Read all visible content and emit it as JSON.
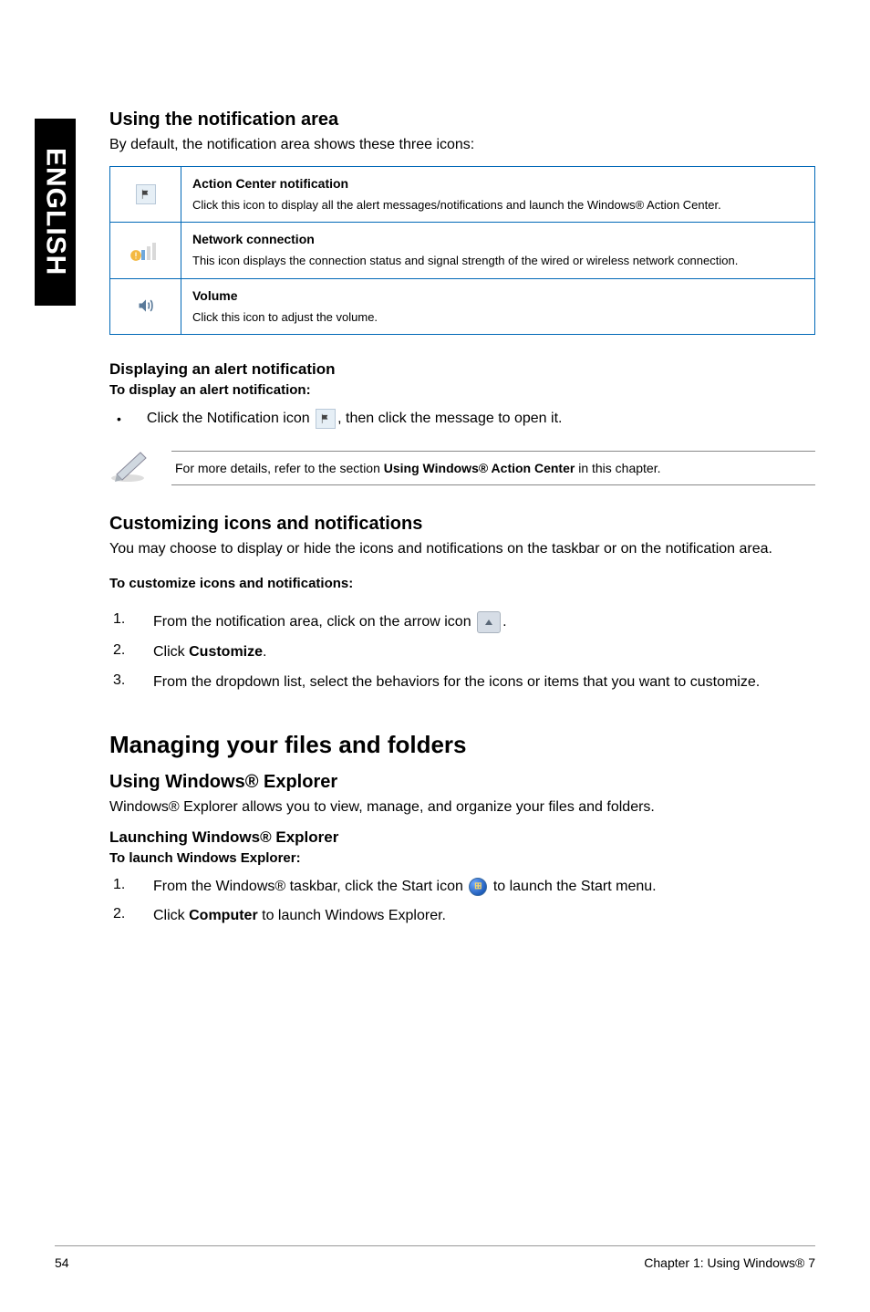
{
  "sidebar": {
    "language": "ENGLISH"
  },
  "section1": {
    "title": "Using the notification area",
    "intro": "By default, the notification area shows these three icons:"
  },
  "table": {
    "row1": {
      "title": "Action Center notification",
      "desc": "Click this icon to display all the alert messages/notifications and launch the Windows® Action Center."
    },
    "row2": {
      "title": "Network connection",
      "desc": "This icon displays the connection status and signal strength of the wired or wireless network connection."
    },
    "row3": {
      "title": "Volume",
      "desc": "Click this icon to adjust the volume."
    }
  },
  "section2": {
    "title": "Displaying an alert notification",
    "subtitle": "To display an alert notification:",
    "bullet_pre": "Click the Notification icon",
    "bullet_post": ", then click the message to open it."
  },
  "note": {
    "pre": "For more details, refer to the section ",
    "bold": "Using Windows® Action Center",
    "post": " in this chapter."
  },
  "section3": {
    "title": "Customizing icons and notifications",
    "intro": "You may choose to display or hide the icons and notifications on the taskbar or on the notification area.",
    "subtitle": "To customize icons and notifications:",
    "step1_pre": "From the notification area, click on the arrow icon",
    "step1_post": ".",
    "step2_pre": "Click ",
    "step2_bold": "Customize",
    "step2_post": ".",
    "step3": "From the dropdown list, select the behaviors for the icons or items that you want to customize."
  },
  "main2": {
    "heading": "Managing your files and folders",
    "sub1": "Using Windows® Explorer",
    "intro": "Windows® Explorer allows you to view, manage, and organize your files and folders.",
    "sub2": "Launching Windows® Explorer",
    "sub3": "To launch Windows Explorer:",
    "step1_pre": "From the Windows® taskbar, click the Start icon",
    "step1_post": "to launch the Start menu.",
    "step2_pre": "Click ",
    "step2_bold": "Computer",
    "step2_post": " to launch Windows Explorer."
  },
  "footer": {
    "page": "54",
    "chapter": "Chapter 1: Using Windows® 7"
  }
}
